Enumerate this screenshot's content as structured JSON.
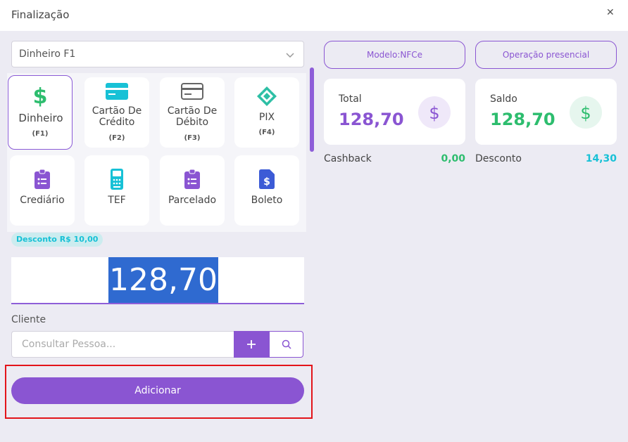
{
  "window": {
    "title": "Finalização"
  },
  "payment_select": {
    "value": "Dinheiro F1"
  },
  "payment_methods": [
    {
      "label": "Dinheiro",
      "key": "(F1)",
      "icon": "dollar-icon"
    },
    {
      "label": "Cartão De Crédito",
      "key": "(F2)",
      "icon": "credit-card-icon"
    },
    {
      "label": "Cartão De Débito",
      "key": "(F3)",
      "icon": "debit-card-icon"
    },
    {
      "label": "PIX",
      "key": "(F4)",
      "icon": "pix-icon"
    },
    {
      "label": "Crediário",
      "icon": "clipboard-icon"
    },
    {
      "label": "TEF",
      "icon": "pos-terminal-icon"
    },
    {
      "label": "Parcelado",
      "icon": "clipboard-icon"
    },
    {
      "label": "Boleto",
      "icon": "invoice-icon"
    }
  ],
  "discount_badge": "Desconto R$ 10,00",
  "amount": "128,70",
  "cliente": {
    "label": "Cliente",
    "placeholder": "Consultar Pessoa..."
  },
  "add_button": "Adicionar",
  "modelo_pill": "Modelo:NFCe",
  "operacao_pill": "Operação presencial",
  "total": {
    "label": "Total",
    "value": "128,70"
  },
  "saldo": {
    "label": "Saldo",
    "value": "128,70"
  },
  "cashback": {
    "label": "Cashback",
    "value": "0,00"
  },
  "desconto": {
    "label": "Desconto",
    "value": "14,30"
  },
  "colors": {
    "accent": "#8a55d2",
    "green": "#2dbd6e",
    "cyan": "#17c1d6",
    "highlight": "#e3141a"
  }
}
